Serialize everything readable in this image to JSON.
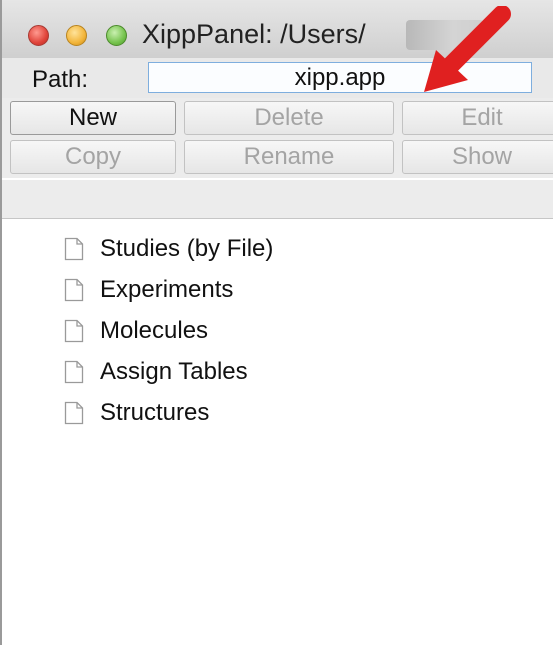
{
  "window": {
    "title": "XippPanel: /Users/"
  },
  "path": {
    "label": "Path:",
    "value": "xipp.app"
  },
  "buttons": {
    "row1": [
      {
        "label": "New",
        "enabled": true
      },
      {
        "label": "Delete",
        "enabled": false
      },
      {
        "label": "Edit",
        "enabled": false
      }
    ],
    "row2": [
      {
        "label": "Copy",
        "enabled": false
      },
      {
        "label": "Rename",
        "enabled": false
      },
      {
        "label": "Show",
        "enabled": false
      }
    ]
  },
  "tree": {
    "items": [
      {
        "label": "Studies (by File)",
        "icon": "document-icon"
      },
      {
        "label": "Experiments",
        "icon": "document-icon"
      },
      {
        "label": "Molecules",
        "icon": "document-icon"
      },
      {
        "label": "Assign Tables",
        "icon": "document-icon"
      },
      {
        "label": "Structures",
        "icon": "document-icon"
      }
    ]
  },
  "colors": {
    "arrow": "#e02020",
    "field_border": "#7eaede"
  }
}
